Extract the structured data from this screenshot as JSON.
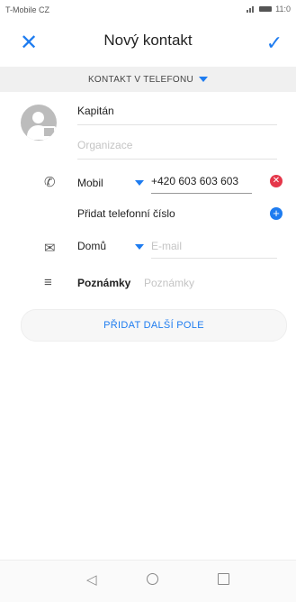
{
  "status_bar": {
    "carrier": "T-Mobile CZ",
    "time": "11:0"
  },
  "header": {
    "title": "Nový kontakt",
    "close_icon": "close-icon",
    "save_icon": "check-icon"
  },
  "account_selector": {
    "label": "KONTAKT V TELEFONU"
  },
  "contact": {
    "name_value": "Kapitán",
    "organization_placeholder": "Organizace"
  },
  "phone": {
    "type_label": "Mobil",
    "number_value": "+420 603 603 603",
    "add_label": "Přidat telefonní číslo"
  },
  "email": {
    "type_label": "Domů",
    "placeholder": "E-mail"
  },
  "notes": {
    "label": "Poznámky",
    "placeholder": "Poznámky"
  },
  "add_field_label": "PŘIDAT DALŠÍ POLE",
  "colors": {
    "accent": "#1e7cf0",
    "danger": "#e5374a"
  }
}
